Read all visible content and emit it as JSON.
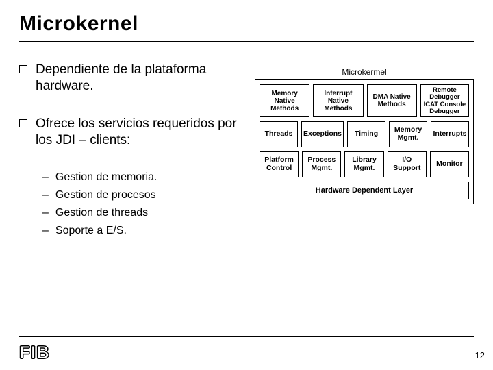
{
  "title": "Microkernel",
  "bullets": [
    "Dependiente de la plataforma hardware.",
    "Ofrece los servicios requeridos por los JDI – clients:"
  ],
  "subbullets": [
    "Gestion de memoria.",
    "Gestion de procesos",
    "Gestion de threads",
    "Soporte a E/S."
  ],
  "diagram": {
    "title": "Microkermel",
    "row1": [
      "Memory Native Methods",
      "Interrupt Native Methods",
      "DMA Native Methods"
    ],
    "row1_right": [
      "Remote Debugger",
      "ICAT Console Debugger"
    ],
    "row2": [
      "Threads",
      "Exceptions",
      "Timing",
      "Memory Mgmt.",
      "Interrupts"
    ],
    "row3": [
      "Platform Control",
      "Process Mgmt.",
      "Library Mgmt.",
      "I/O Support",
      "Monitor"
    ],
    "hdl": "Hardware Dependent Layer"
  },
  "logo": "FIB",
  "page": "12"
}
